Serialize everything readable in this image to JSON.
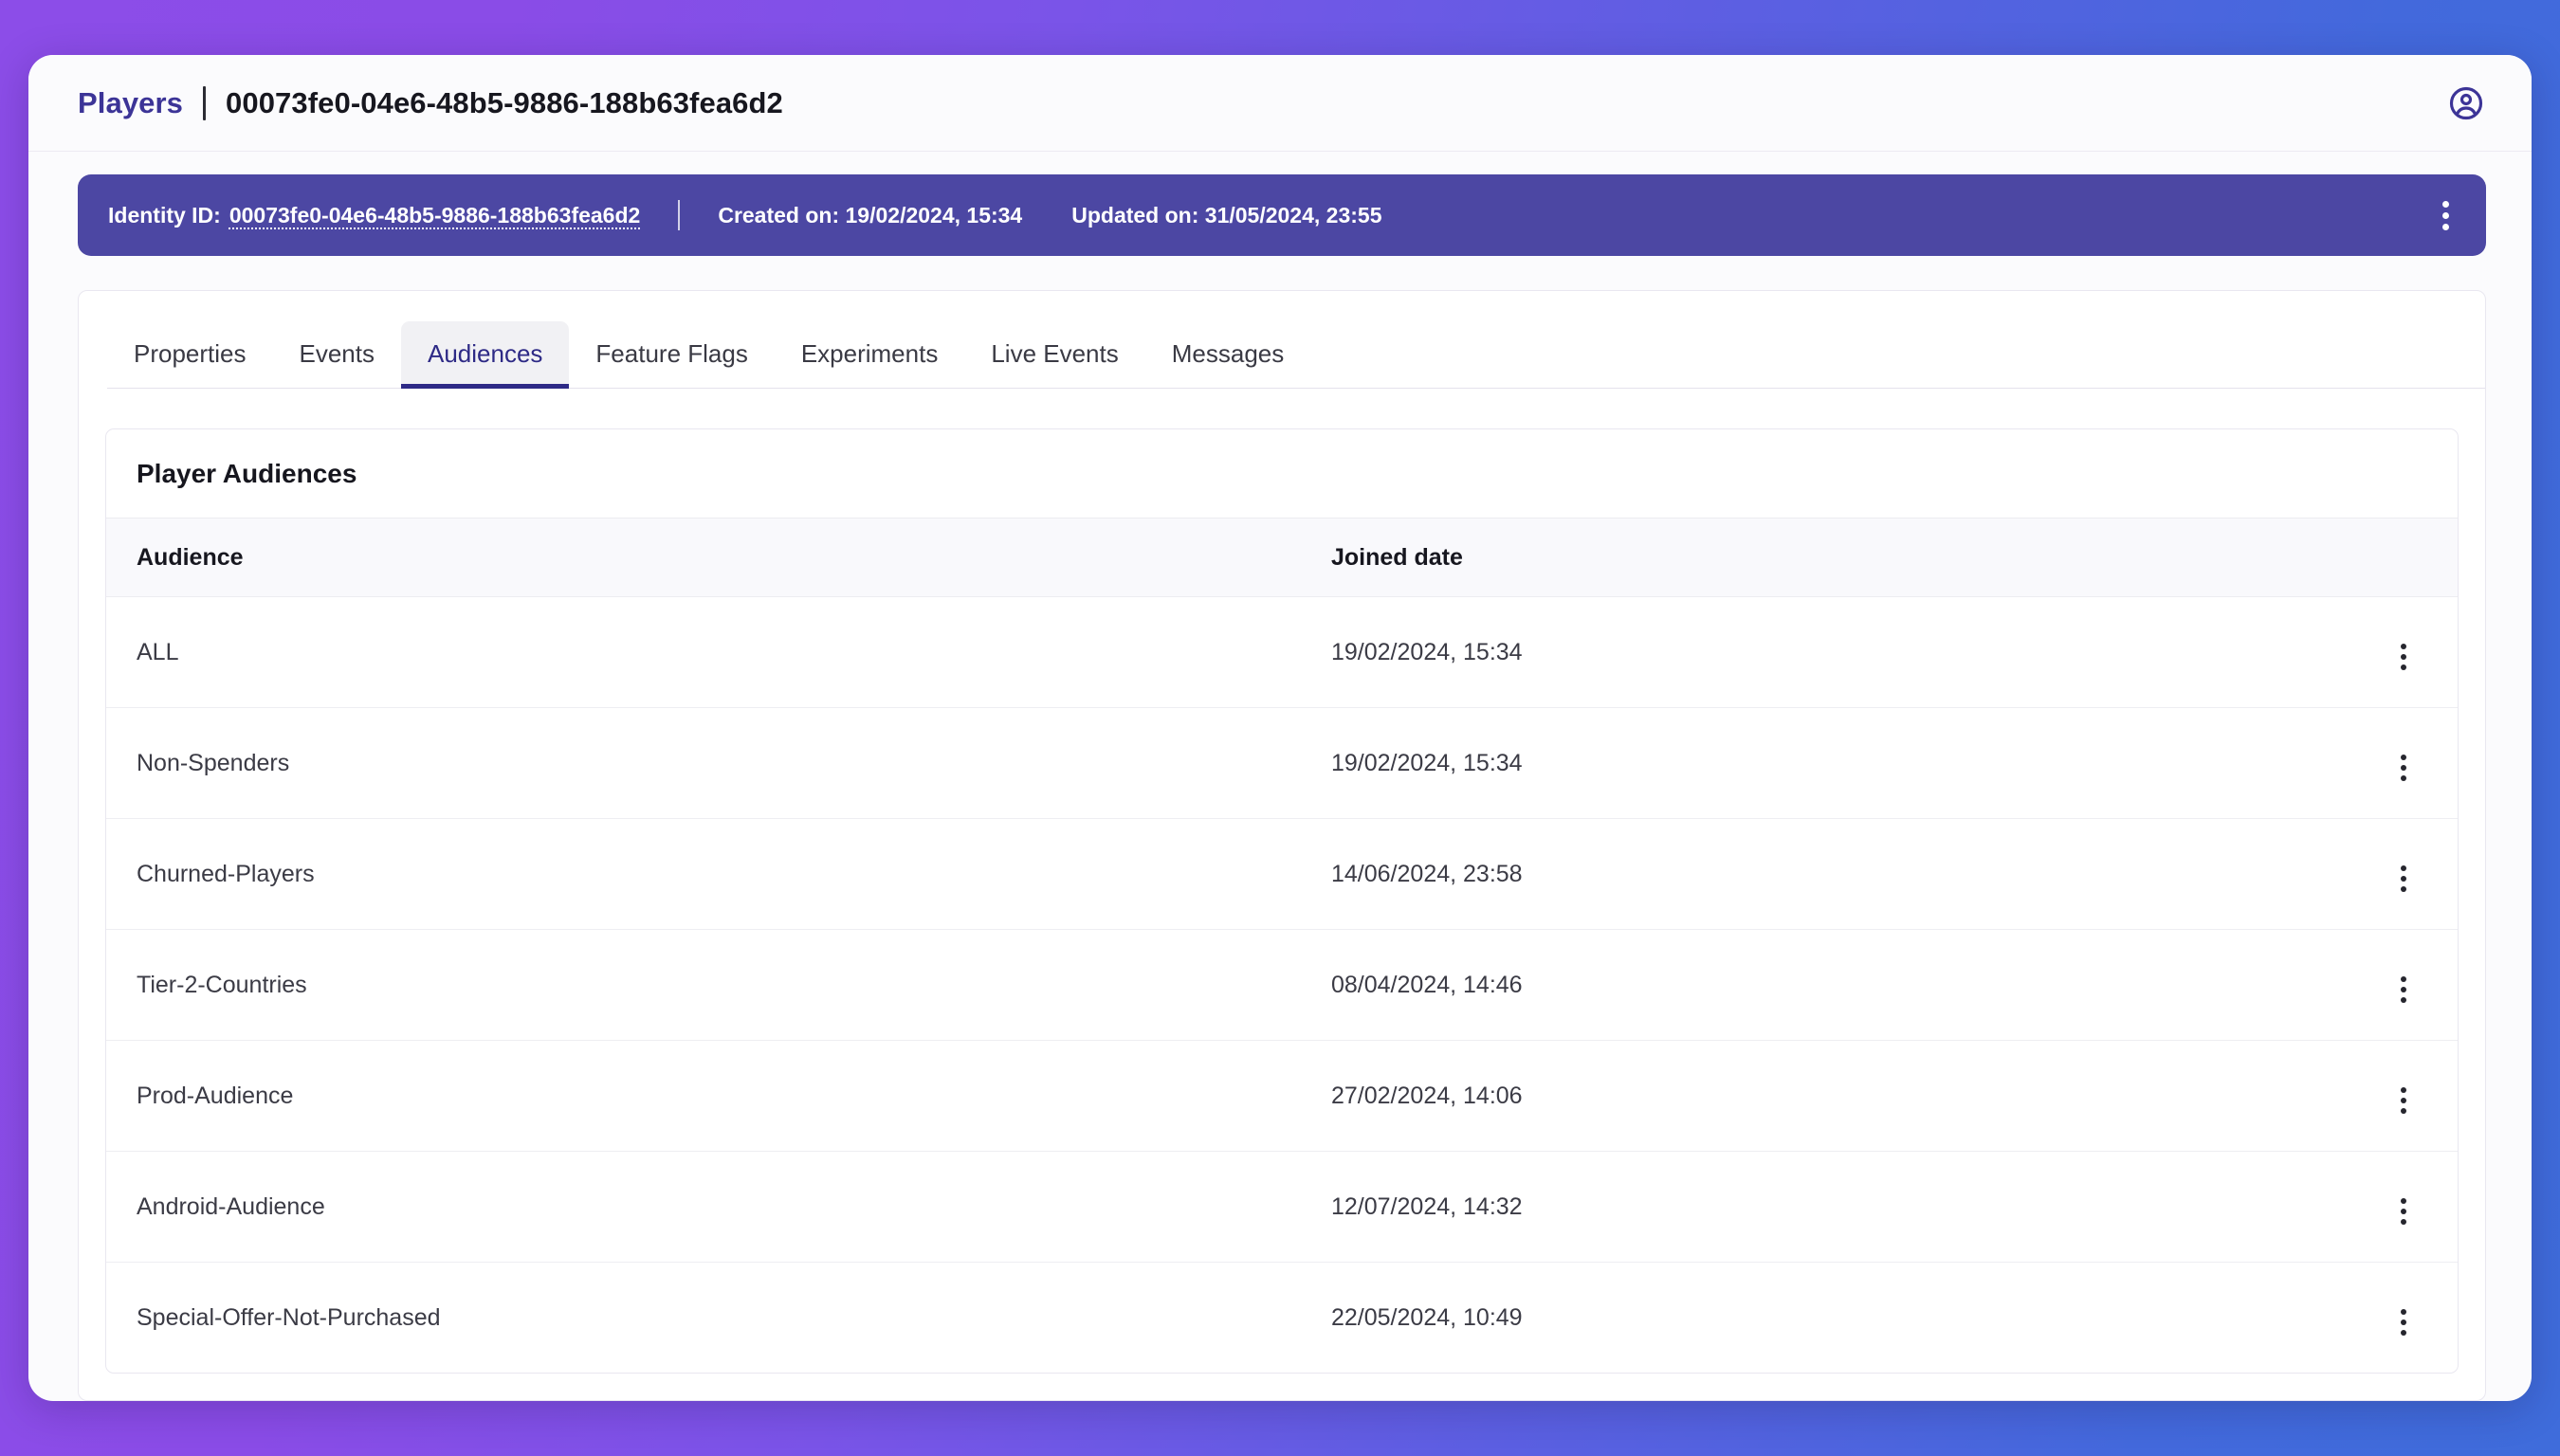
{
  "header": {
    "breadcrumb_root": "Players",
    "breadcrumb_separator": "|",
    "player_id": "00073fe0-04e6-48b5-9886-188b63fea6d2",
    "account_icon": "account-circle-icon"
  },
  "identity_bar": {
    "identity_label": "Identity ID:",
    "identity_value": "00073fe0-04e6-48b5-9886-188b63fea6d2",
    "created_on": "Created on: 19/02/2024, 15:34",
    "updated_on": "Updated on: 31/05/2024, 23:55",
    "menu_icon": "kebab-menu-icon",
    "background_color": "#4c47a3"
  },
  "tabs": [
    {
      "label": "Properties",
      "active": false
    },
    {
      "label": "Events",
      "active": false
    },
    {
      "label": "Audiences",
      "active": true
    },
    {
      "label": "Feature Flags",
      "active": false
    },
    {
      "label": "Experiments",
      "active": false
    },
    {
      "label": "Live Events",
      "active": false
    },
    {
      "label": "Messages",
      "active": false
    }
  ],
  "panel": {
    "title": "Player Audiences",
    "columns": {
      "audience": "Audience",
      "joined_date": "Joined date",
      "actions": ""
    },
    "rows": [
      {
        "audience": "ALL",
        "joined_date": "19/02/2024, 15:34",
        "menu_icon": "kebab-menu-icon"
      },
      {
        "audience": "Non-Spenders",
        "joined_date": "19/02/2024, 15:34",
        "menu_icon": "kebab-menu-icon"
      },
      {
        "audience": "Churned-Players",
        "joined_date": "14/06/2024, 23:58",
        "menu_icon": "kebab-menu-icon"
      },
      {
        "audience": "Tier-2-Countries",
        "joined_date": "08/04/2024, 14:46",
        "menu_icon": "kebab-menu-icon"
      },
      {
        "audience": "Prod-Audience",
        "joined_date": "27/02/2024, 14:06",
        "menu_icon": "kebab-menu-icon"
      },
      {
        "audience": "Android-Audience",
        "joined_date": "12/07/2024, 14:32",
        "menu_icon": "kebab-menu-icon"
      },
      {
        "audience": "Special-Offer-Not-Purchased",
        "joined_date": "22/05/2024, 10:49",
        "menu_icon": "kebab-menu-icon"
      }
    ]
  },
  "theme": {
    "brand_indigo": "#3c3497",
    "identity_purple": "#4c47a3",
    "active_tab_indigo": "#2e2a86",
    "gradient_start": "#8c4de8",
    "gradient_end": "#3f6cdb"
  }
}
